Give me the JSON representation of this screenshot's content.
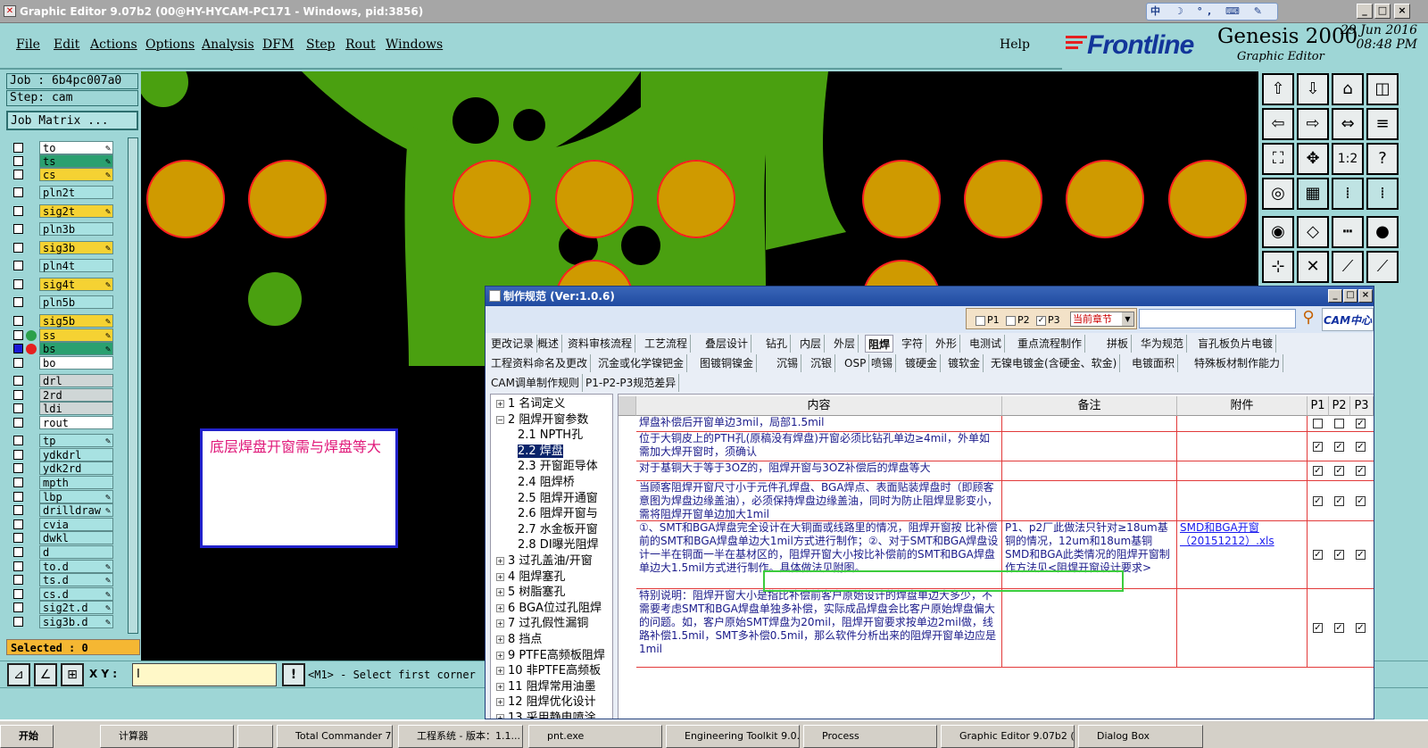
{
  "window": {
    "title": "Graphic Editor 9.07b2 (00@HY-HYCAM-PC171 - Windows, pid:3856)",
    "tray_text": "中 ☽ °, ⌨ ✎ ✂",
    "btn_min": "_",
    "btn_max": "□",
    "btn_close": "×"
  },
  "menu": {
    "items": [
      "File",
      "Edit",
      "Actions",
      "Options",
      "Analysis",
      "DFM",
      "Step",
      "Rout",
      "Windows"
    ],
    "help": "Help"
  },
  "brand": {
    "logo": "Frontline",
    "product": "Genesis 2000",
    "subtitle": "Graphic Editor",
    "date": "29 Jun 2016",
    "time": "08:48 PM"
  },
  "left": {
    "job": "Job : 6b4pc007a0",
    "step": "Step: cam",
    "job_matrix": "Job Matrix ...",
    "selected": "Selected : 0",
    "layers": [
      {
        "name": "to",
        "style": "white"
      },
      {
        "name": "ts",
        "style": "green"
      },
      {
        "name": "cs",
        "style": "yel"
      },
      {
        "name": "pln2t",
        "style": "cyan"
      },
      {
        "name": "sig2t",
        "style": "yel"
      },
      {
        "name": "pln3b",
        "style": "cyan"
      },
      {
        "name": "sig3b",
        "style": "yel"
      },
      {
        "name": "pln4t",
        "style": "cyan"
      },
      {
        "name": "sig4t",
        "style": "yel"
      },
      {
        "name": "pln5b",
        "style": "cyan"
      },
      {
        "name": "sig5b",
        "style": "yel"
      },
      {
        "name": "ss",
        "style": "yel"
      },
      {
        "name": "bs",
        "style": "green"
      },
      {
        "name": "bo",
        "style": "white"
      },
      {
        "name": "drl",
        "style": "gray"
      },
      {
        "name": "2rd",
        "style": "gray"
      },
      {
        "name": "ldi",
        "style": "gray"
      },
      {
        "name": "rout",
        "style": "white"
      },
      {
        "name": "tp",
        "style": "cyan"
      },
      {
        "name": "ydkdrl",
        "style": "cyan"
      },
      {
        "name": "ydk2rd",
        "style": "cyan"
      },
      {
        "name": "mpth",
        "style": "cyan"
      },
      {
        "name": "lbp",
        "style": "cyan"
      },
      {
        "name": "drilldraw",
        "style": "cyan"
      },
      {
        "name": "cvia",
        "style": "cyan"
      },
      {
        "name": "dwkl",
        "style": "cyan"
      },
      {
        "name": "d",
        "style": "cyan"
      },
      {
        "name": "to.d",
        "style": "cyan"
      },
      {
        "name": "ts.d",
        "style": "cyan"
      },
      {
        "name": "cs.d",
        "style": "cyan"
      },
      {
        "name": "sig2t.d",
        "style": "cyan"
      },
      {
        "name": "sig3b.d",
        "style": "cyan"
      }
    ]
  },
  "canvas": {
    "note": "底层焊盘开窗需与焊盘等大",
    "colors": {
      "board": "#4aa010",
      "pad": "#cf9a00",
      "outline": "#ff2020",
      "bg": "#000000"
    }
  },
  "coord": {
    "xy_label": "X Y :",
    "xy_value": "I",
    "prompt": "<M1> - Select first corner"
  },
  "taskbar": {
    "start": "开始",
    "items": [
      "计算器",
      "",
      "Total Commander 7.0...",
      "工程系统 - 版本：1.1...",
      "pnt.exe",
      "Engineering Toolkit 9.0...",
      "Process",
      "Graphic Editor 9.07b2 (...",
      "Dialog Box"
    ]
  },
  "dialog": {
    "title": "制作规范 (Ver:1.0.6)",
    "filters": {
      "p1": "P1",
      "p2": "P2",
      "p3": "P3",
      "chapter": "当前章节"
    },
    "cam_logo": "CAM中心",
    "tabs_row1": [
      "更改记录",
      "概述",
      "资料审核流程",
      "工艺流程",
      "叠层设计",
      "钻孔",
      "内层",
      "外层",
      "阻焊",
      "字符",
      "外形",
      "电测试",
      "重点流程制作",
      "拼板",
      "华为规范",
      "盲孔板负片电镀"
    ],
    "tabs_row2": [
      "工程资料命名及更改",
      "沉金或化学镍钯金",
      "图镀铜镍金",
      "沉锡",
      "沉银",
      "OSP",
      "喷锡",
      "镀硬金",
      "镀软金",
      "无镍电镀金(含硬金、软金)",
      "电镀面积",
      "特殊板材制作能力"
    ],
    "tabs_row3": [
      "CAM调单制作规则",
      "P1-P2-P3规范差异"
    ],
    "active_tab": "阻焊",
    "tree": [
      {
        "t": "1 名词定义",
        "pm": "+",
        "lvl": 0
      },
      {
        "t": "2 阻焊开窗参数",
        "pm": "-",
        "lvl": 0
      },
      {
        "t": "2.1 NPTH孔",
        "lvl": 1
      },
      {
        "t": "2.2 焊盘",
        "lvl": 1,
        "sel": true
      },
      {
        "t": "2.3 开窗距导体",
        "lvl": 1
      },
      {
        "t": "2.4 阻焊桥",
        "lvl": 1
      },
      {
        "t": "2.5 阻焊开通窗",
        "lvl": 1
      },
      {
        "t": "2.6 阻焊开窗与",
        "lvl": 1
      },
      {
        "t": "2.7 水金板开窗",
        "lvl": 1
      },
      {
        "t": "2.8 DI曝光阻焊",
        "lvl": 1
      },
      {
        "t": "3 过孔盖油/开窗",
        "pm": "+",
        "lvl": 0
      },
      {
        "t": "4 阻焊塞孔",
        "pm": "+",
        "lvl": 0
      },
      {
        "t": "5 树脂塞孔",
        "pm": "+",
        "lvl": 0
      },
      {
        "t": "6 BGA位过孔阻焊",
        "pm": "+",
        "lvl": 0
      },
      {
        "t": "7 过孔假性漏铜",
        "pm": "+",
        "lvl": 0
      },
      {
        "t": "8 挡点",
        "pm": "+",
        "lvl": 0
      },
      {
        "t": "9 PTFE高频板阻焊",
        "pm": "+",
        "lvl": 0
      },
      {
        "t": "10 非PTFE高频板",
        "pm": "+",
        "lvl": 0
      },
      {
        "t": "11 阻焊常用油墨",
        "pm": "+",
        "lvl": 0
      },
      {
        "t": "12 阻焊优化设计",
        "pm": "+",
        "lvl": 0
      },
      {
        "t": "13 采用静电喷涂",
        "pm": "+",
        "lvl": 0
      }
    ],
    "columns": [
      "内容",
      "备注",
      "附件",
      "P1",
      "P2",
      "P3"
    ],
    "rows": [
      {
        "content": "焊盘补偿后开窗单边3mil，局部1.5mil",
        "note": "",
        "att": "",
        "p": [
          false,
          false,
          true
        ]
      },
      {
        "content": "位于大铜皮上的PTH孔(原稿没有焊盘)开窗必须比钻孔单边≥4mil，外单如需加大焊开窗时，须确认",
        "note": "",
        "att": "",
        "p": [
          true,
          true,
          true
        ]
      },
      {
        "content": "对于基铜大于等于3OZ的，阻焊开窗与3OZ补偿后的焊盘等大",
        "note": "",
        "att": "",
        "p": [
          true,
          true,
          true
        ]
      },
      {
        "content": "当顾客阻焊开窗尺寸小于元件孔焊盘、BGA焊点、表面贴装焊盘时（即顾客意图为焊盘边缘盖油），必须保持焊盘边缘盖油，同时为防止阻焊显影变小，需将阻焊开窗单边加大1mil",
        "note": "",
        "att": "",
        "p": [
          true,
          true,
          true
        ]
      },
      {
        "content": "①、SMT和BGA焊盘完全设计在大铜面或线路里的情况，阻焊开窗按 比补偿前的SMT和BGA焊盘单边大1mil方式进行制作；②、对于SMT和BGA焊盘设计一半在铜面一半在基材区的，阻焊开窗大小按比补偿前的SMT和BGA焊盘单边大1.5mil方式进行制作。具体做法见附图。",
        "note": "P1、p2厂此做法只针对≥18um基铜的情况，12um和18um基铜SMD和BGA此类情况的阻焊开窗制作方法见<阻焊开窗设计要求>",
        "att": "SMD和BGA开窗（20151212）.xls",
        "p": [
          true,
          true,
          true
        ]
      },
      {
        "content": "特别说明：阻焊开窗大小是指比补偿前客户原始设计的焊盘单边大多少，不需要考虑SMT和BGA焊盘单独多补偿，实际成品焊盘会比客户原始焊盘偏大的问题。如，客户原始SMT焊盘为20mil，阻焊开窗要求按单边2mil做，线路补偿1.5mil，SMT多补偿0.5mil，那么软件分析出来的阻焊开窗单边应是1mil",
        "note": "",
        "att": "",
        "p": [
          true,
          true,
          true
        ]
      }
    ]
  }
}
